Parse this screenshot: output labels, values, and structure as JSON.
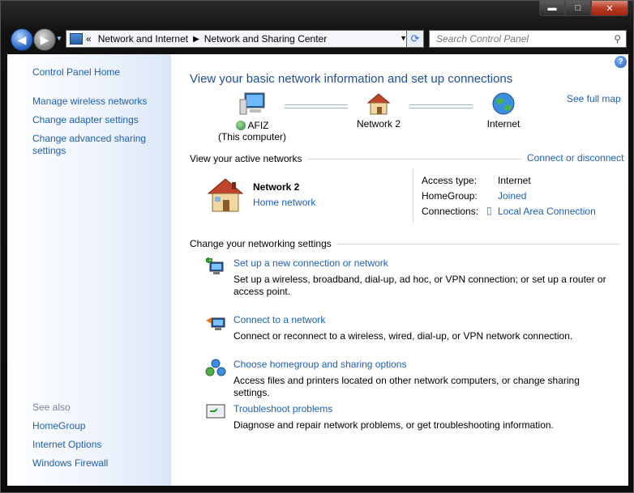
{
  "window": {
    "controls": {
      "minimize": "▬",
      "maximize": "□",
      "close": "✕"
    }
  },
  "nav": {
    "breadcrumb_prefix": "«",
    "crumb1": "Network and Internet",
    "crumb2": "Network and Sharing Center",
    "search_placeholder": "Search Control Panel"
  },
  "sidebar": {
    "home": "Control Panel Home",
    "items": [
      {
        "label": "Manage wireless networks"
      },
      {
        "label": "Change adapter settings"
      },
      {
        "label": "Change advanced sharing settings"
      }
    ],
    "see_also_label": "See also",
    "see_also": [
      {
        "label": "HomeGroup"
      },
      {
        "label": "Internet Options"
      },
      {
        "label": "Windows Firewall"
      }
    ]
  },
  "main": {
    "heading": "View your basic network information and set up connections",
    "see_full_map": "See full map",
    "map": {
      "computer_name": "AFIZ",
      "computer_sub": "(This computer)",
      "network": "Network  2",
      "internet": "Internet"
    },
    "active_networks_label": "View your active networks",
    "connect_disconnect": "Connect or disconnect",
    "active": {
      "name": "Network  2",
      "type": "Home network",
      "access_type_label": "Access type:",
      "access_type_value": "Internet",
      "homegroup_label": "HomeGroup:",
      "homegroup_value": "Joined",
      "connections_label": "Connections:",
      "connections_value": "Local Area Connection"
    },
    "change_settings_label": "Change your networking settings",
    "tasks": [
      {
        "title": "Set up a new connection or network",
        "desc": "Set up a wireless, broadband, dial-up, ad hoc, or VPN connection; or set up a router or access point."
      },
      {
        "title": "Connect to a network",
        "desc": "Connect or reconnect to a wireless, wired, dial-up, or VPN network connection."
      },
      {
        "title": "Choose homegroup and sharing options",
        "desc": "Access files and printers located on other network computers, or change sharing settings."
      },
      {
        "title": "Troubleshoot problems",
        "desc": "Diagnose and repair network problems, or get troubleshooting information."
      }
    ]
  }
}
